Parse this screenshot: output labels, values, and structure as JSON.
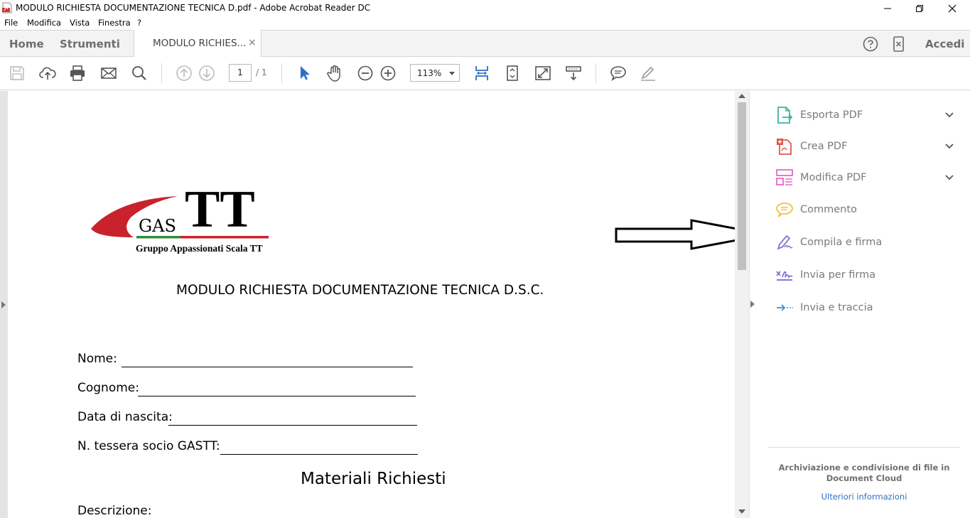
{
  "window": {
    "title": "MODULO RICHIESTA DOCUMENTAZIONE TECNICA D.pdf - Adobe Acrobat Reader DC"
  },
  "menu": [
    "File",
    "Modifica",
    "Vista",
    "Finestra",
    "?"
  ],
  "tabs": {
    "home": "Home",
    "tools": "Strumenti",
    "document": "MODULO RICHIES...",
    "close": "×",
    "sign_in": "Accedi"
  },
  "toolbar": {
    "page_current": "1",
    "page_total": "/ 1",
    "zoom": "113%"
  },
  "document": {
    "logo": {
      "gas": "GAS",
      "tt": "TT",
      "tagline": "Gruppo Appassionati Scala TT"
    },
    "heading": "MODULO RICHIESTA DOCUMENTAZIONE TECNICA D.S.C.",
    "fields": {
      "name": "Nome: ",
      "surname": "Cognome:",
      "birth": "Data di nascita:",
      "card": "N. tessera socio GASTT: "
    },
    "section": "Materiali Richiesti",
    "description": "Descrizione:"
  },
  "tools_pane": {
    "items": [
      {
        "label": "Esporta PDF",
        "color": "#3db39e",
        "expand": true
      },
      {
        "label": "Crea PDF",
        "color": "#e0574f",
        "expand": true
      },
      {
        "label": "Modifica PDF",
        "color": "#e56ac4",
        "expand": true
      },
      {
        "label": "Commento",
        "color": "#f2c230",
        "expand": false
      },
      {
        "label": "Compila e firma",
        "color": "#8c6fd6",
        "expand": false
      },
      {
        "label": "Invia per firma",
        "color": "#7b62d4",
        "expand": false
      },
      {
        "label": "Invia e traccia",
        "color": "#3b8fd9",
        "expand": false
      }
    ],
    "cloud_text": "Archiviazione e condivisione di file in Document Cloud",
    "cloud_link": "Ulteriori informazioni"
  },
  "colors": {
    "accent_blue": "#2d6fc3",
    "logo_red": "#c8232c",
    "logo_green": "#2f8f3a"
  }
}
